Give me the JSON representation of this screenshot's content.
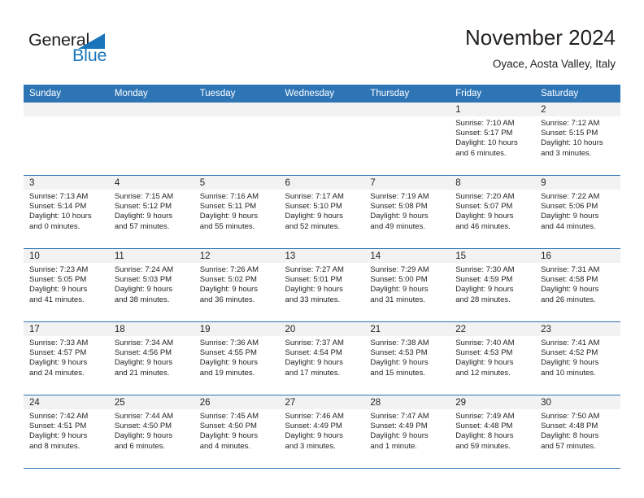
{
  "brand": {
    "name_part1": "General",
    "name_part2": "Blue",
    "triangle_color": "#1b75bb",
    "accent_color": "#2e75b6"
  },
  "header": {
    "title": "November 2024",
    "subtitle": "Oyace, Aosta Valley, Italy"
  },
  "weekday_headers": [
    "Sunday",
    "Monday",
    "Tuesday",
    "Wednesday",
    "Thursday",
    "Friday",
    "Saturday"
  ],
  "weeks": [
    [
      {
        "day": "",
        "sunrise": "",
        "sunset": "",
        "daylight_line1": "",
        "daylight_line2": ""
      },
      {
        "day": "",
        "sunrise": "",
        "sunset": "",
        "daylight_line1": "",
        "daylight_line2": ""
      },
      {
        "day": "",
        "sunrise": "",
        "sunset": "",
        "daylight_line1": "",
        "daylight_line2": ""
      },
      {
        "day": "",
        "sunrise": "",
        "sunset": "",
        "daylight_line1": "",
        "daylight_line2": ""
      },
      {
        "day": "",
        "sunrise": "",
        "sunset": "",
        "daylight_line1": "",
        "daylight_line2": ""
      },
      {
        "day": "1",
        "sunrise": "Sunrise: 7:10 AM",
        "sunset": "Sunset: 5:17 PM",
        "daylight_line1": "Daylight: 10 hours",
        "daylight_line2": "and 6 minutes."
      },
      {
        "day": "2",
        "sunrise": "Sunrise: 7:12 AM",
        "sunset": "Sunset: 5:15 PM",
        "daylight_line1": "Daylight: 10 hours",
        "daylight_line2": "and 3 minutes."
      }
    ],
    [
      {
        "day": "3",
        "sunrise": "Sunrise: 7:13 AM",
        "sunset": "Sunset: 5:14 PM",
        "daylight_line1": "Daylight: 10 hours",
        "daylight_line2": "and 0 minutes."
      },
      {
        "day": "4",
        "sunrise": "Sunrise: 7:15 AM",
        "sunset": "Sunset: 5:12 PM",
        "daylight_line1": "Daylight: 9 hours",
        "daylight_line2": "and 57 minutes."
      },
      {
        "day": "5",
        "sunrise": "Sunrise: 7:16 AM",
        "sunset": "Sunset: 5:11 PM",
        "daylight_line1": "Daylight: 9 hours",
        "daylight_line2": "and 55 minutes."
      },
      {
        "day": "6",
        "sunrise": "Sunrise: 7:17 AM",
        "sunset": "Sunset: 5:10 PM",
        "daylight_line1": "Daylight: 9 hours",
        "daylight_line2": "and 52 minutes."
      },
      {
        "day": "7",
        "sunrise": "Sunrise: 7:19 AM",
        "sunset": "Sunset: 5:08 PM",
        "daylight_line1": "Daylight: 9 hours",
        "daylight_line2": "and 49 minutes."
      },
      {
        "day": "8",
        "sunrise": "Sunrise: 7:20 AM",
        "sunset": "Sunset: 5:07 PM",
        "daylight_line1": "Daylight: 9 hours",
        "daylight_line2": "and 46 minutes."
      },
      {
        "day": "9",
        "sunrise": "Sunrise: 7:22 AM",
        "sunset": "Sunset: 5:06 PM",
        "daylight_line1": "Daylight: 9 hours",
        "daylight_line2": "and 44 minutes."
      }
    ],
    [
      {
        "day": "10",
        "sunrise": "Sunrise: 7:23 AM",
        "sunset": "Sunset: 5:05 PM",
        "daylight_line1": "Daylight: 9 hours",
        "daylight_line2": "and 41 minutes."
      },
      {
        "day": "11",
        "sunrise": "Sunrise: 7:24 AM",
        "sunset": "Sunset: 5:03 PM",
        "daylight_line1": "Daylight: 9 hours",
        "daylight_line2": "and 38 minutes."
      },
      {
        "day": "12",
        "sunrise": "Sunrise: 7:26 AM",
        "sunset": "Sunset: 5:02 PM",
        "daylight_line1": "Daylight: 9 hours",
        "daylight_line2": "and 36 minutes."
      },
      {
        "day": "13",
        "sunrise": "Sunrise: 7:27 AM",
        "sunset": "Sunset: 5:01 PM",
        "daylight_line1": "Daylight: 9 hours",
        "daylight_line2": "and 33 minutes."
      },
      {
        "day": "14",
        "sunrise": "Sunrise: 7:29 AM",
        "sunset": "Sunset: 5:00 PM",
        "daylight_line1": "Daylight: 9 hours",
        "daylight_line2": "and 31 minutes."
      },
      {
        "day": "15",
        "sunrise": "Sunrise: 7:30 AM",
        "sunset": "Sunset: 4:59 PM",
        "daylight_line1": "Daylight: 9 hours",
        "daylight_line2": "and 28 minutes."
      },
      {
        "day": "16",
        "sunrise": "Sunrise: 7:31 AM",
        "sunset": "Sunset: 4:58 PM",
        "daylight_line1": "Daylight: 9 hours",
        "daylight_line2": "and 26 minutes."
      }
    ],
    [
      {
        "day": "17",
        "sunrise": "Sunrise: 7:33 AM",
        "sunset": "Sunset: 4:57 PM",
        "daylight_line1": "Daylight: 9 hours",
        "daylight_line2": "and 24 minutes."
      },
      {
        "day": "18",
        "sunrise": "Sunrise: 7:34 AM",
        "sunset": "Sunset: 4:56 PM",
        "daylight_line1": "Daylight: 9 hours",
        "daylight_line2": "and 21 minutes."
      },
      {
        "day": "19",
        "sunrise": "Sunrise: 7:36 AM",
        "sunset": "Sunset: 4:55 PM",
        "daylight_line1": "Daylight: 9 hours",
        "daylight_line2": "and 19 minutes."
      },
      {
        "day": "20",
        "sunrise": "Sunrise: 7:37 AM",
        "sunset": "Sunset: 4:54 PM",
        "daylight_line1": "Daylight: 9 hours",
        "daylight_line2": "and 17 minutes."
      },
      {
        "day": "21",
        "sunrise": "Sunrise: 7:38 AM",
        "sunset": "Sunset: 4:53 PM",
        "daylight_line1": "Daylight: 9 hours",
        "daylight_line2": "and 15 minutes."
      },
      {
        "day": "22",
        "sunrise": "Sunrise: 7:40 AM",
        "sunset": "Sunset: 4:53 PM",
        "daylight_line1": "Daylight: 9 hours",
        "daylight_line2": "and 12 minutes."
      },
      {
        "day": "23",
        "sunrise": "Sunrise: 7:41 AM",
        "sunset": "Sunset: 4:52 PM",
        "daylight_line1": "Daylight: 9 hours",
        "daylight_line2": "and 10 minutes."
      }
    ],
    [
      {
        "day": "24",
        "sunrise": "Sunrise: 7:42 AM",
        "sunset": "Sunset: 4:51 PM",
        "daylight_line1": "Daylight: 9 hours",
        "daylight_line2": "and 8 minutes."
      },
      {
        "day": "25",
        "sunrise": "Sunrise: 7:44 AM",
        "sunset": "Sunset: 4:50 PM",
        "daylight_line1": "Daylight: 9 hours",
        "daylight_line2": "and 6 minutes."
      },
      {
        "day": "26",
        "sunrise": "Sunrise: 7:45 AM",
        "sunset": "Sunset: 4:50 PM",
        "daylight_line1": "Daylight: 9 hours",
        "daylight_line2": "and 4 minutes."
      },
      {
        "day": "27",
        "sunrise": "Sunrise: 7:46 AM",
        "sunset": "Sunset: 4:49 PM",
        "daylight_line1": "Daylight: 9 hours",
        "daylight_line2": "and 3 minutes."
      },
      {
        "day": "28",
        "sunrise": "Sunrise: 7:47 AM",
        "sunset": "Sunset: 4:49 PM",
        "daylight_line1": "Daylight: 9 hours",
        "daylight_line2": "and 1 minute."
      },
      {
        "day": "29",
        "sunrise": "Sunrise: 7:49 AM",
        "sunset": "Sunset: 4:48 PM",
        "daylight_line1": "Daylight: 8 hours",
        "daylight_line2": "and 59 minutes."
      },
      {
        "day": "30",
        "sunrise": "Sunrise: 7:50 AM",
        "sunset": "Sunset: 4:48 PM",
        "daylight_line1": "Daylight: 8 hours",
        "daylight_line2": "and 57 minutes."
      }
    ]
  ]
}
